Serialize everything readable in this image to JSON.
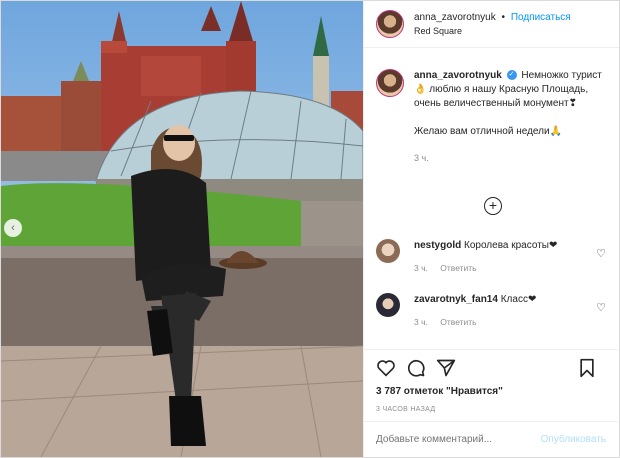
{
  "header": {
    "username": "anna_zavorotnyuk",
    "dot": "•",
    "follow_label": "Подписаться",
    "location": "Red Square"
  },
  "caption": {
    "username": "anna_zavorotnyuk",
    "text1": "Немножко турист👌 люблю я нашу Красную Площадь, очень величественный монумент❣",
    "text2": "Желаю вам отличной недели🙏",
    "time": "3 ч."
  },
  "load_more_icon": "plus-circle-icon",
  "comments": [
    {
      "username": "nestygold",
      "text": "Королева красоты❤",
      "time": "3 ч.",
      "reply_label": "Ответить"
    },
    {
      "username": "zavarotnyk_fan14",
      "text": "Класс❤",
      "time": "3 ч.",
      "reply_label": "Ответить"
    }
  ],
  "actions": {
    "likes_text": "3 787 отметок \"Нравится\"",
    "time_ago": "3 ЧАСОВ НАЗАД"
  },
  "add_comment": {
    "placeholder": "Добавьте комментарий...",
    "publish_label": "Опубликовать"
  },
  "colors": {
    "link": "#0095f6",
    "publish_disabled": "#b2dffc",
    "muted": "#8e8e8e",
    "verified": "#3897f0"
  }
}
